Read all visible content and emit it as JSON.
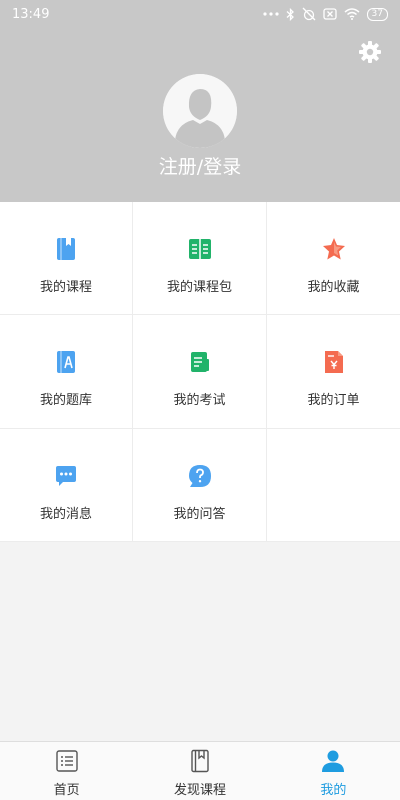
{
  "status_bar": {
    "time": "13:49",
    "battery": "37"
  },
  "header": {
    "login_label": "注册/登录"
  },
  "menu": [
    {
      "label": "我的课程",
      "icon": "course-book-icon",
      "color": "#4da3f0"
    },
    {
      "label": "我的课程包",
      "icon": "open-book-icon",
      "color": "#21b36a"
    },
    {
      "label": "我的收藏",
      "icon": "star-icon",
      "color": "#f46b50"
    },
    {
      "label": "我的题库",
      "icon": "question-bank-icon",
      "color": "#4da3f0"
    },
    {
      "label": "我的考试",
      "icon": "exam-icon",
      "color": "#21b36a"
    },
    {
      "label": "我的订单",
      "icon": "order-icon",
      "color": "#f46b50"
    },
    {
      "label": "我的消息",
      "icon": "message-icon",
      "color": "#4da3f0"
    },
    {
      "label": "我的问答",
      "icon": "question-icon",
      "color": "#4da3f0"
    }
  ],
  "tabs": [
    {
      "label": "首页",
      "icon": "home-list-icon",
      "active": false
    },
    {
      "label": "发现课程",
      "icon": "discover-book-icon",
      "active": false
    },
    {
      "label": "我的",
      "icon": "person-icon",
      "active": true
    }
  ],
  "colors": {
    "header_bg": "#c8c8c8",
    "accent": "#1e9ce0"
  }
}
